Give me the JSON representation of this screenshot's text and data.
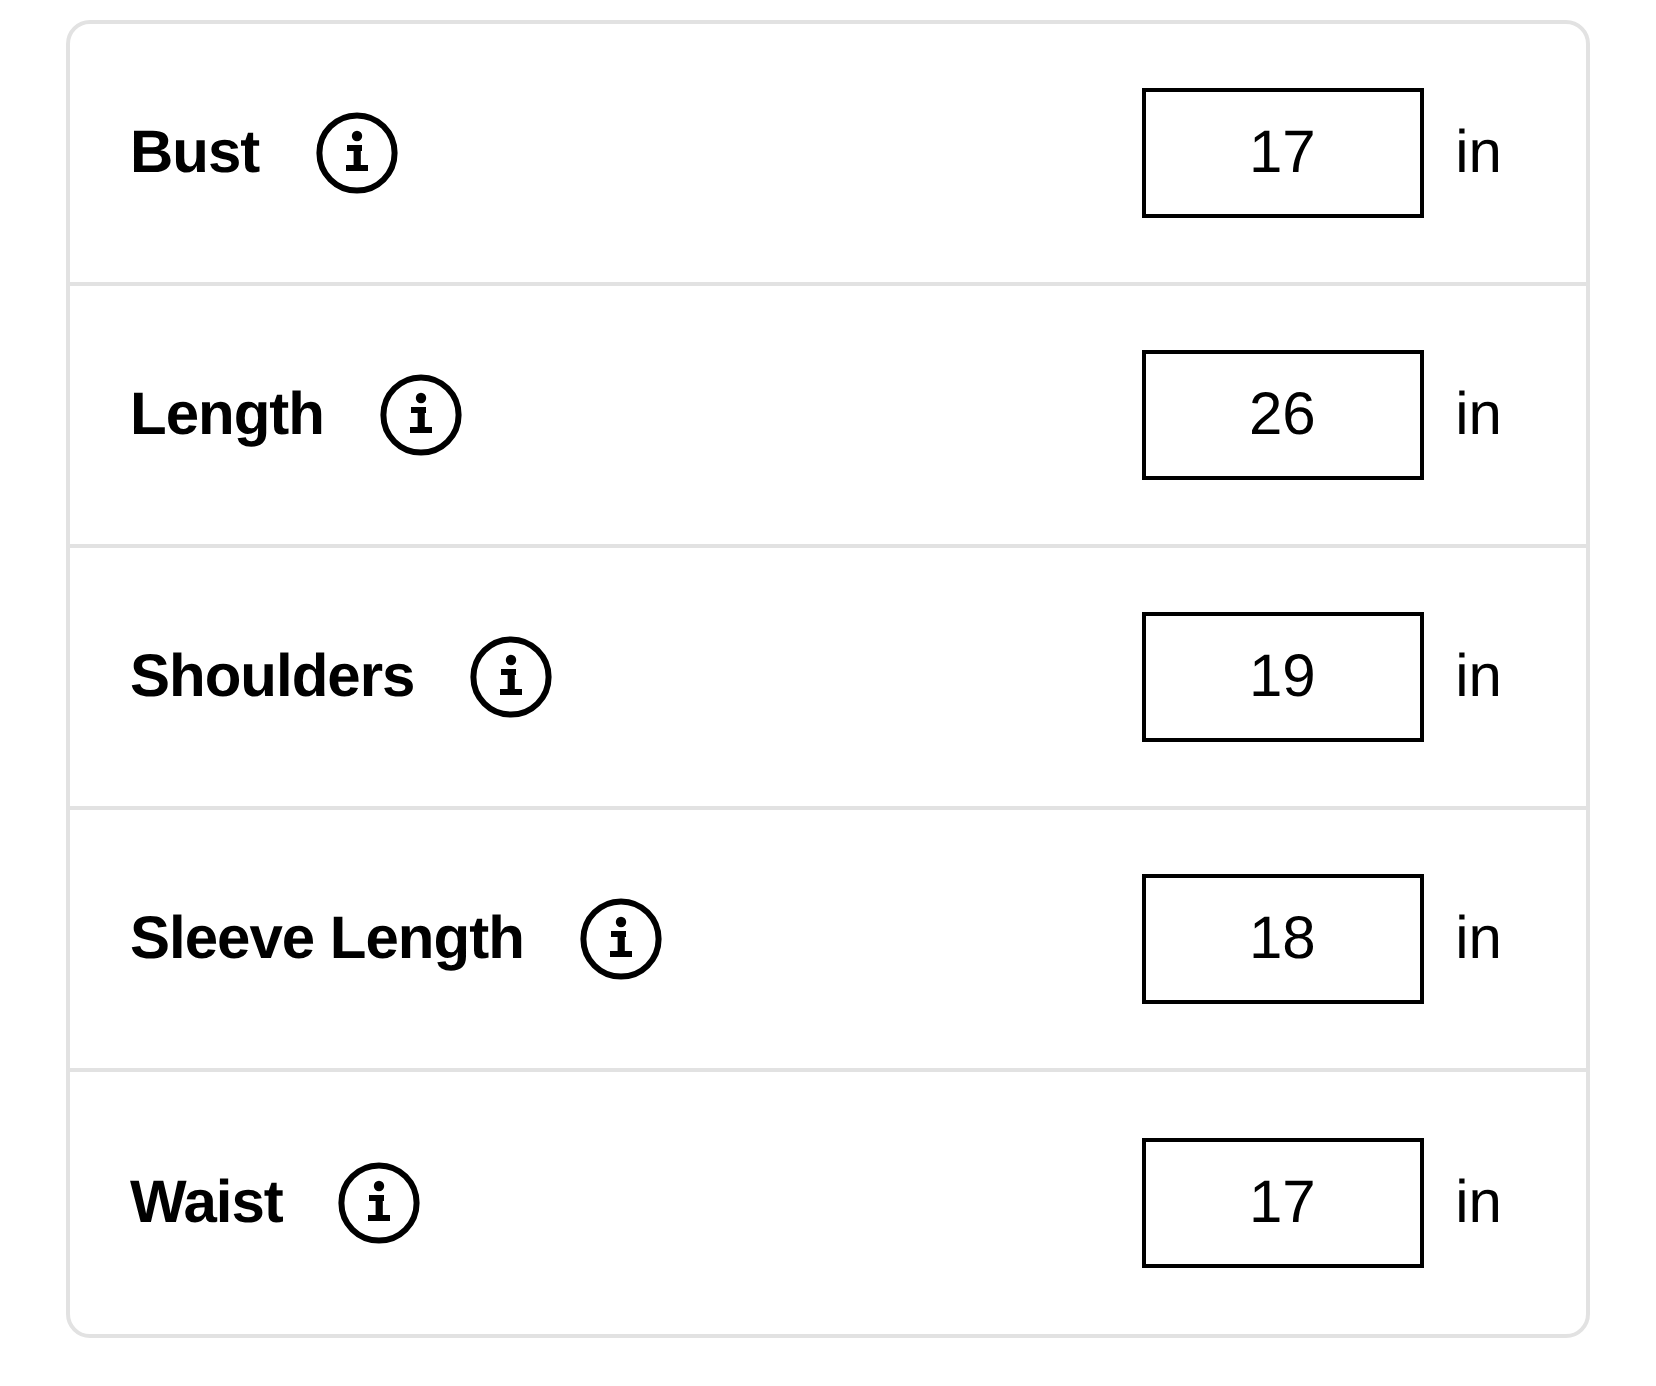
{
  "measurements": [
    {
      "label": "Bust",
      "value": "17",
      "unit": "in"
    },
    {
      "label": "Length",
      "value": "26",
      "unit": "in"
    },
    {
      "label": "Shoulders",
      "value": "19",
      "unit": "in"
    },
    {
      "label": "Sleeve Length",
      "value": "18",
      "unit": "in"
    },
    {
      "label": "Waist",
      "value": "17",
      "unit": "in"
    }
  ]
}
